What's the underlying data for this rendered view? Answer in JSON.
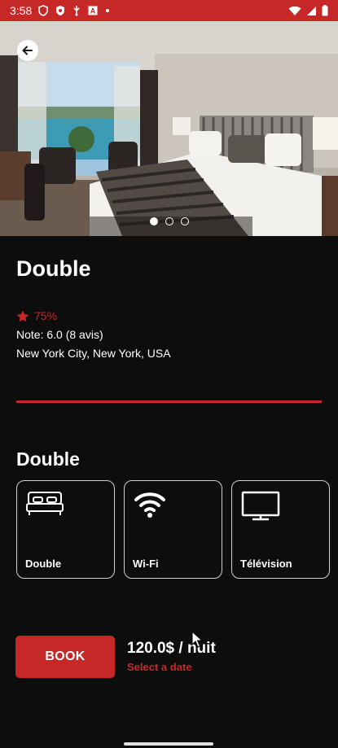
{
  "status_bar": {
    "time": "3:58",
    "icons": [
      "shield-icon",
      "shield-filled-icon",
      "usb-icon",
      "a-box-icon",
      "dot-icon"
    ],
    "right_icons": [
      "wifi-icon",
      "signal-icon",
      "battery-icon"
    ]
  },
  "hero": {
    "image": "hotel-room-photo",
    "slides": 3,
    "active_slide": 0
  },
  "room": {
    "title": "Double",
    "rating_percent": "75%",
    "note": "Note: 6.0 (8 avis)",
    "location": "New York City, New York, USA"
  },
  "details": {
    "section_title": "Double",
    "amenities": [
      {
        "label": "Double",
        "icon": "bed-icon"
      },
      {
        "label": "Wi-Fi",
        "icon": "wifi-icon"
      },
      {
        "label": "Télévision",
        "icon": "tv-icon"
      }
    ]
  },
  "booking": {
    "button_label": "BOOK",
    "price": "120.0$ / nuit",
    "select_date": "Select a date"
  },
  "colors": {
    "accent": "#c62828",
    "background": "#0d0d0d",
    "text": "#ffffff"
  }
}
